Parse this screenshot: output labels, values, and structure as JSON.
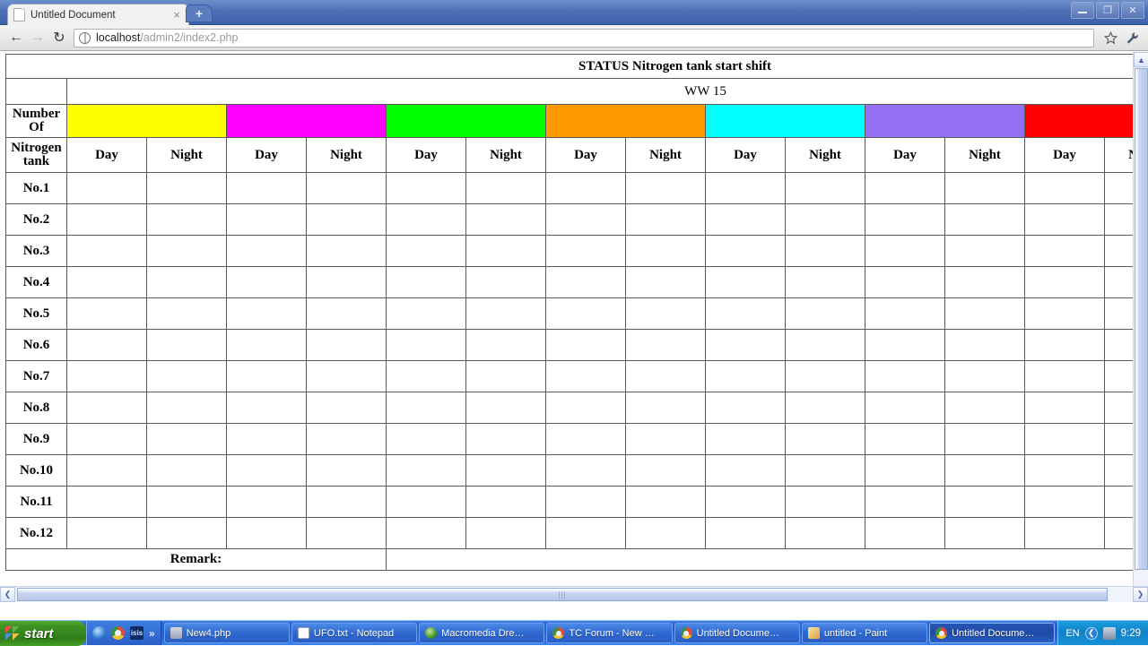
{
  "browser": {
    "tab": {
      "title": "Untitled Document",
      "favicon": "page-icon",
      "close": "×"
    },
    "newtab_label": "+",
    "window_controls": {
      "minimize": "–",
      "restore": "❐",
      "close": "✕"
    },
    "toolbar": {
      "back": "←",
      "forward": "→",
      "reload": "↻",
      "url_host": "localhost",
      "url_path": "/admin2/index2.php",
      "bookmark": "☆",
      "menu": "🔧"
    }
  },
  "page": {
    "title": "STATUS Nitrogen tank start shift",
    "week": "WW 15",
    "row_header_top": "Number Of",
    "row_header_bottom": "Nitrogen tank",
    "shift_labels": [
      "Day",
      "Night"
    ],
    "remark_label": "Remark:",
    "group_colors": [
      "#ffff00",
      "#ff00ff",
      "#00ff00",
      "#ff9900",
      "#00ffff",
      "#9370f5",
      "#ff0000",
      "#ffff00"
    ],
    "row_labels": [
      "No.1",
      "No.2",
      "No.3",
      "No.4",
      "No.5",
      "No.6",
      "No.7",
      "No.8",
      "No.9",
      "No.10",
      "No.11",
      "No.12"
    ],
    "label_cell_color": "#90f58f",
    "border_color": "#5a5a5a"
  },
  "scrollbars": {
    "v_up": "▲",
    "v_down": "▼",
    "h_left": "❮",
    "h_right": "❯"
  },
  "taskbar": {
    "start_label": "start",
    "quicklaunch": [
      {
        "name": "ie-icon",
        "text": ""
      },
      {
        "name": "chrome-icon",
        "text": ""
      },
      {
        "name": "isis-icon",
        "text": "isis"
      }
    ],
    "quicklaunch_more": "»",
    "tasks": [
      {
        "label": "New4.php",
        "icon": "php",
        "active": false
      },
      {
        "label": "UFO.txt - Notepad",
        "icon": "notepad",
        "active": false
      },
      {
        "label": "Macromedia Dre…",
        "icon": "dream",
        "active": false
      },
      {
        "label": "TC Forum - New …",
        "icon": "chrome",
        "active": false
      },
      {
        "label": "Untitled Docume…",
        "icon": "chrome",
        "active": false
      },
      {
        "label": "untitled - Paint",
        "icon": "paint",
        "active": false
      },
      {
        "label": "Untitled Docume…",
        "icon": "chrome",
        "active": true
      }
    ],
    "tray": {
      "language": "EN",
      "chevron": "❮",
      "clock": "9:29"
    }
  }
}
